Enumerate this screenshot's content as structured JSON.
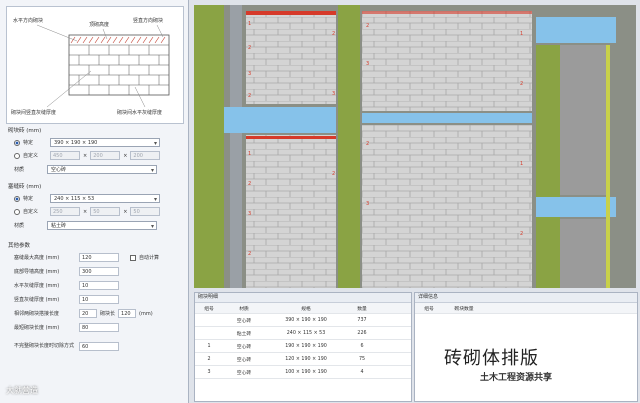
{
  "left_panel": {
    "preview_labels": {
      "top_left": "水平方向砌块",
      "top_mid": "顶砌高度",
      "top_right": "竖直方向砌块",
      "bottom_left": "砌块间竖直灰缝厚度",
      "bottom_right": "砌块间水平灰缝厚度"
    },
    "block_group": {
      "title": "砌块砖 (mm)",
      "fixed_label": "特定",
      "fixed_value": "390 × 190 × 190",
      "custom_label": "自定义",
      "custom_vals": [
        "450",
        "200",
        "200"
      ],
      "material_label": "材质",
      "material_value": "空心砖"
    },
    "top_brick_group": {
      "title": "塞缝砖 (mm)",
      "fixed_label": "特定",
      "fixed_value": "240 × 115 × 53",
      "custom_label": "自定义",
      "custom_vals": [
        "250",
        "50",
        "50"
      ],
      "material_label": "材质",
      "material_value": "粘土砖"
    },
    "params": {
      "title": "其他参数",
      "items": [
        {
          "label": "塞缝最大高度 (mm)",
          "value": "120"
        },
        {
          "label": "底部导墙高度 (mm)",
          "value": "300"
        },
        {
          "label": "水平灰缝厚度 (mm)",
          "value": "10"
        },
        {
          "label": "竖直灰缝厚度 (mm)",
          "value": "10"
        },
        {
          "label": "相邻两砌块搭接长度",
          "value": "20"
        },
        {
          "label": "最短砌块长度 (mm)",
          "value": "80"
        },
        {
          "label": "不完整砌块长度时切除方式",
          "value": "60"
        }
      ],
      "auto_calc_label": "自动计算",
      "block_len_label": "砌块长",
      "block_len_value": "120",
      "mm_unit": "(mm)"
    }
  },
  "bottom_left": {
    "title": "砌块明细",
    "headers": [
      "组号",
      "材质",
      "规格",
      "数量"
    ],
    "rows": [
      [
        "",
        "空心砖",
        "390 × 190 × 190",
        "737"
      ],
      [
        "",
        "粘土砖",
        "240 × 115 × 53",
        "226"
      ],
      [
        "1",
        "空心砖",
        "190 × 190 × 190",
        "6"
      ],
      [
        "2",
        "空心砖",
        "120 × 190 × 190",
        "75"
      ],
      [
        "3",
        "空心砖",
        "100 × 190 × 190",
        "4"
      ]
    ]
  },
  "bottom_right": {
    "title": "详细信息",
    "headers": [
      "组号",
      "砌块数量"
    ]
  },
  "caption": "砖砌体排版",
  "watermark_left": "大就营造",
  "watermark_right": "土木工程资源共享",
  "colors": {
    "column_green": "#8aa344",
    "brick_gray": "#d4d4d4",
    "mortar": "#a8a8a8",
    "beam_blue": "#86c2ea",
    "marker_red": "#d63a2a"
  }
}
